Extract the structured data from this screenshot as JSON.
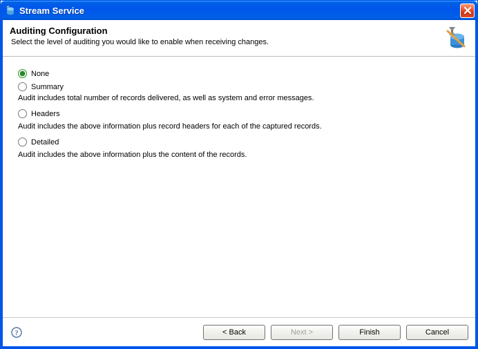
{
  "window": {
    "title": "Stream Service"
  },
  "header": {
    "title": "Auditing Configuration",
    "subtitle": "Select the level of auditing you would like to enable when receiving changes."
  },
  "options": {
    "none": {
      "label": "None",
      "selected": true
    },
    "summary": {
      "label": "Summary",
      "selected": false,
      "description": "Audit includes total number of records delivered, as well as system and error messages."
    },
    "headers": {
      "label": "Headers",
      "selected": false,
      "description": "Audit includes the above information plus record headers for each of the captured records."
    },
    "detailed": {
      "label": "Detailed",
      "selected": false,
      "description": "Audit includes the above information plus the content of the records."
    }
  },
  "buttons": {
    "back": "< Back",
    "next": "Next >",
    "finish": "Finish",
    "cancel": "Cancel"
  }
}
